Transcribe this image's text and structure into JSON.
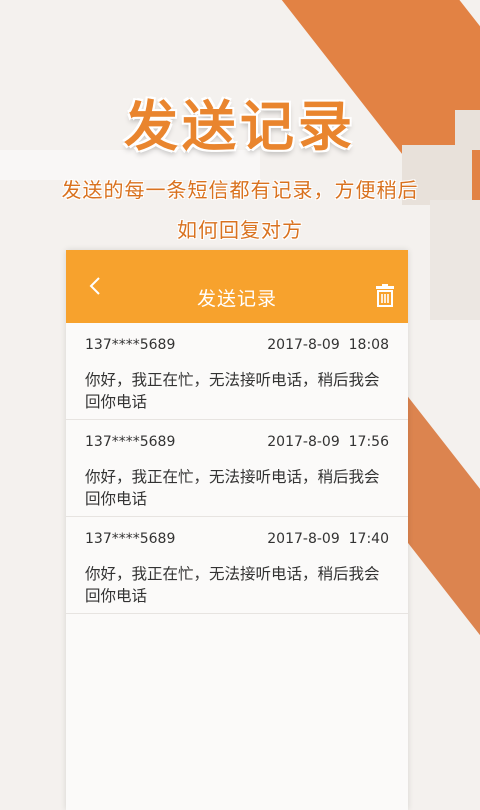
{
  "promo": {
    "title": "发送记录",
    "subtitle_line1": "发送的每一条短信都有记录，方便稍后",
    "subtitle_line2": "如何回复对方"
  },
  "appbar": {
    "title": "发送记录",
    "back_icon": "chevron-left-icon",
    "delete_icon": "trash-icon"
  },
  "records": [
    {
      "phone": "137****5689",
      "date": "2017-8-09",
      "time": "18:08",
      "message": "你好，我正在忙，无法接听电话，稍后我会回你电话"
    },
    {
      "phone": "137****5689",
      "date": "2017-8-09",
      "time": "17:56",
      "message": "你好，我正在忙，无法接听电话，稍后我会回你电话"
    },
    {
      "phone": "137****5689",
      "date": "2017-8-09",
      "time": "17:40",
      "message": "你好，我正在忙，无法接听电话，稍后我会回你电话"
    }
  ],
  "colors": {
    "accent": "#f7a22d",
    "title_orange": "#e9852e",
    "stripe": "#e07b3a"
  }
}
